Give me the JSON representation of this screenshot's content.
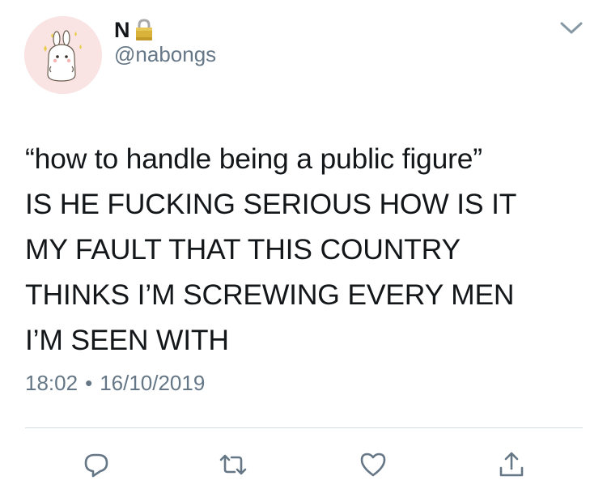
{
  "user": {
    "display_name": "N",
    "handle": "@nabongs",
    "avatar_icon": "bunny-avatar-icon",
    "protected_icon": "lock-icon"
  },
  "tweet": {
    "text": "“how to handle being a public figure”\nIS HE FUCKING SERIOUS HOW IS IT\nMY FAULT THAT THIS COUNTRY\nTHINKS I’M SCREWING EVERY MEN\nI’M SEEN WITH",
    "time": "18:02",
    "separator": "•",
    "date": "16/10/2019"
  },
  "actions": {
    "reply_icon": "reply-icon",
    "retweet_icon": "retweet-icon",
    "like_icon": "heart-icon",
    "share_icon": "share-icon",
    "more_icon": "chevron-down-icon"
  },
  "colors": {
    "text": "#14171a",
    "secondary": "#657786",
    "divider": "#d6dbe0",
    "avatar_bg": "#f9e3e3",
    "lock_gold": "#d9b23a"
  }
}
